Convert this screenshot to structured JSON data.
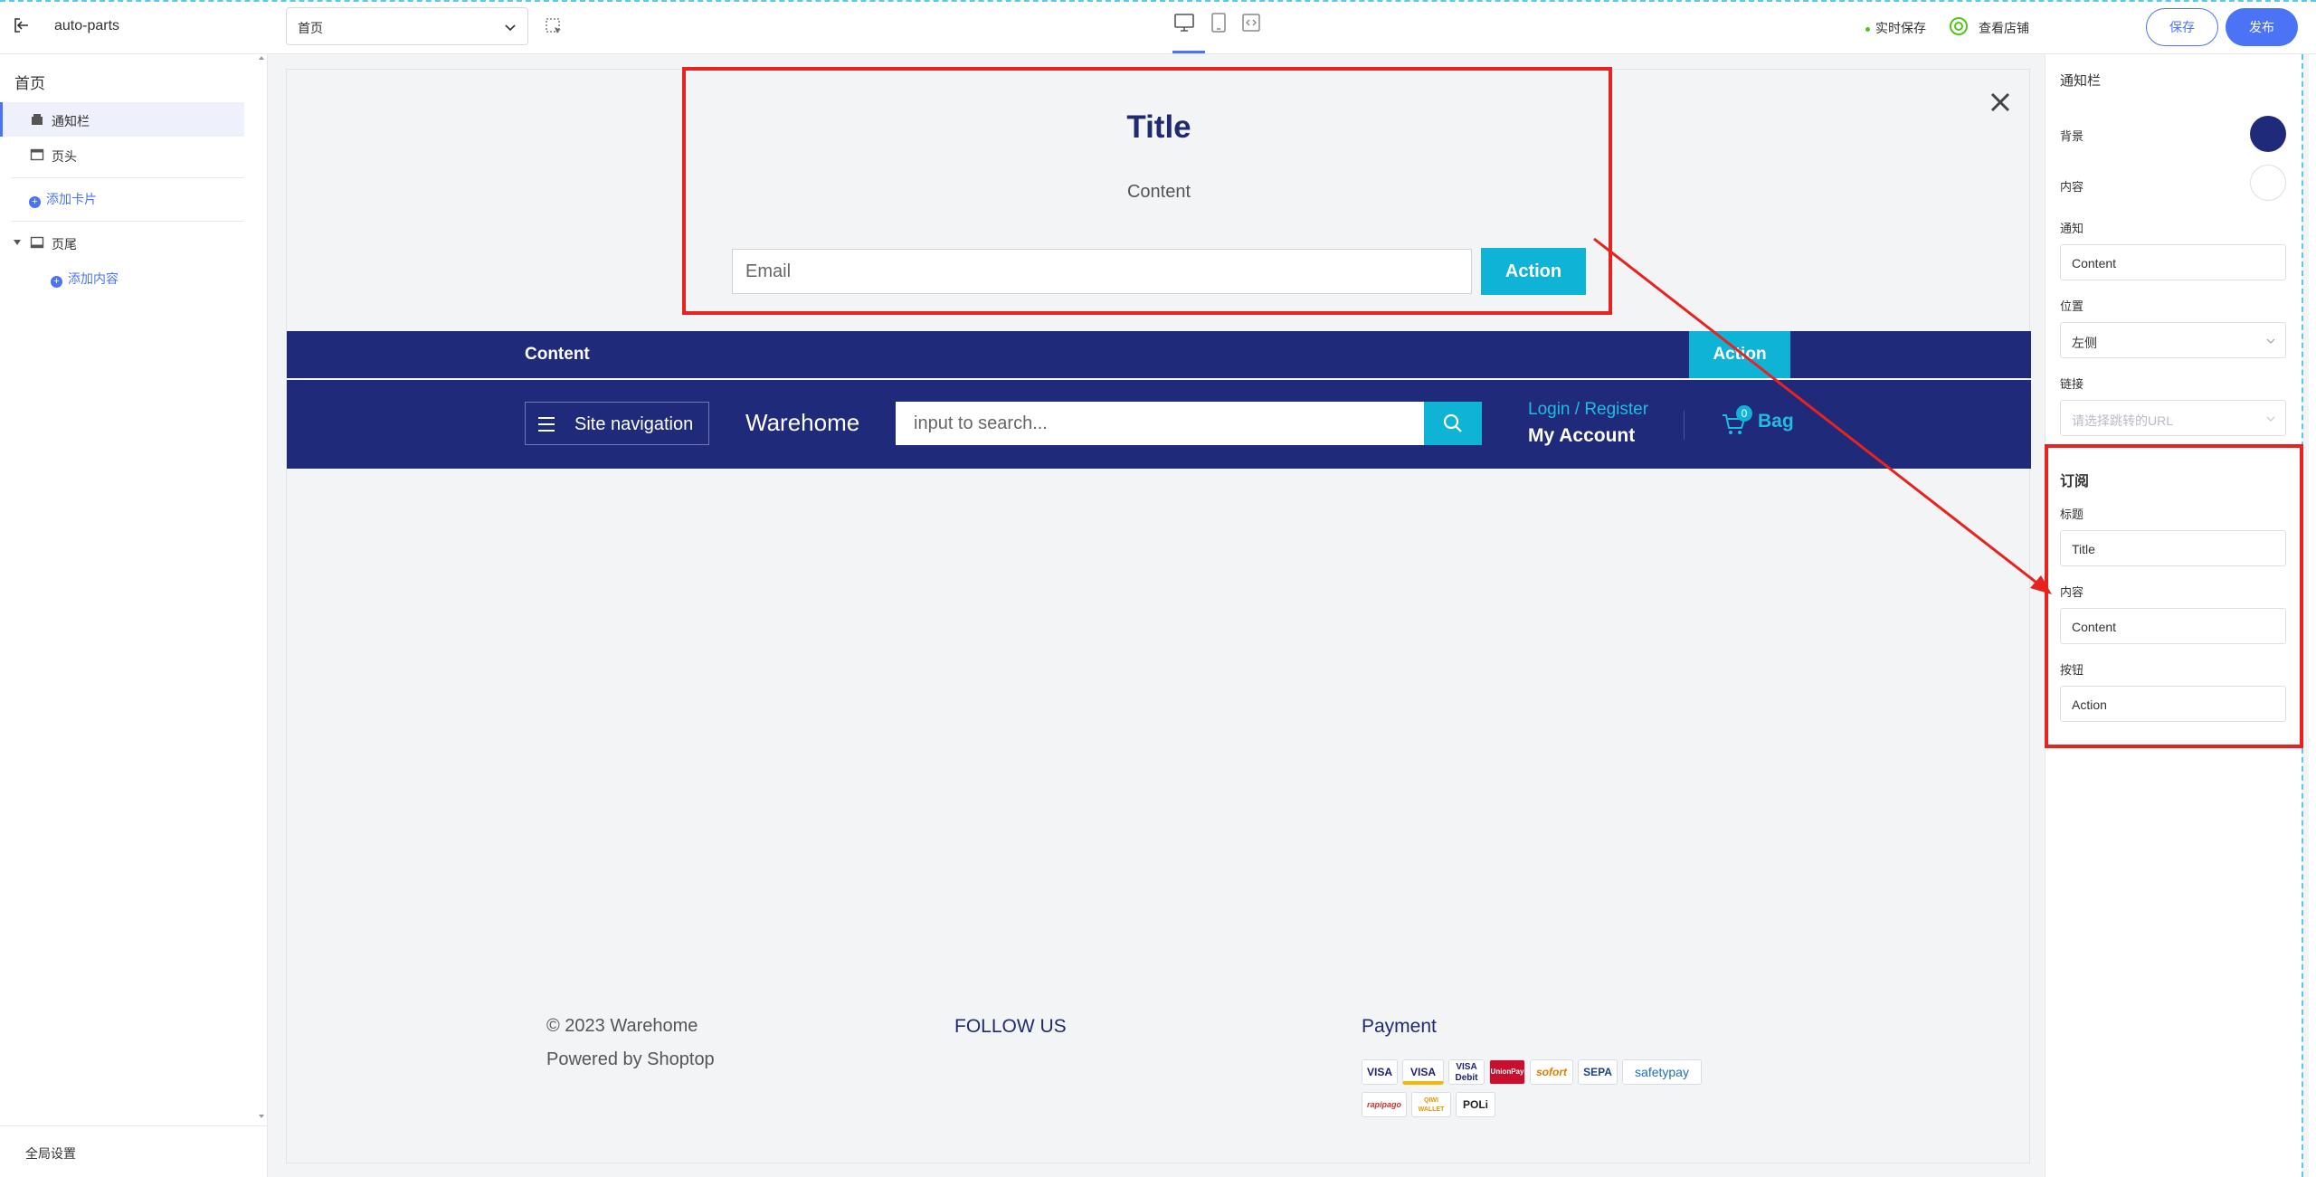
{
  "topbar": {
    "app_name": "auto-parts",
    "page_select_value": "首页",
    "autosave_label": "实时保存",
    "view_store_label": "查看店铺",
    "save_label": "保存",
    "publish_label": "发布"
  },
  "sidebar": {
    "title": "首页",
    "items": [
      {
        "label": "通知栏"
      },
      {
        "label": "页头"
      },
      {
        "label": "页尾"
      }
    ],
    "add_card_label": "添加卡片",
    "add_content_label": "添加内容",
    "global_settings_label": "全局设置"
  },
  "canvas": {
    "subscribe": {
      "title": "Title",
      "content": "Content",
      "email_placeholder": "Email",
      "action_label": "Action"
    },
    "announcement": {
      "content": "Content",
      "action_label": "Action"
    },
    "header": {
      "site_nav_label": "Site navigation",
      "brand": "Warehome",
      "search_placeholder": "input to search...",
      "login_label": "Login / Register",
      "account_label": "My Account",
      "bag_count": "0",
      "bag_label": "Bag"
    },
    "footer": {
      "copyright": "© 2023 Warehome",
      "powered_by": "Powered by Shoptop",
      "follow_label": "FOLLOW US",
      "payment_label": "Payment",
      "payment_methods_row1": [
        "VISA",
        "VISA",
        "VISA Debit",
        "UnionPay",
        "sofort",
        "SEPA",
        "safetypay"
      ],
      "payment_methods_row2": [
        "rapipago",
        "QIWI WALLET",
        "POLi"
      ]
    }
  },
  "panel": {
    "title": "通知栏",
    "background_label": "背景",
    "background_color": "#1f2a7a",
    "content_label": "内容",
    "content_color": "#ffffff",
    "notice_label": "通知",
    "notice_value": "Content",
    "position_label": "位置",
    "position_value": "左侧",
    "link_label": "链接",
    "link_placeholder": "请选择跳转的URL",
    "subscribe_section_title": "订阅",
    "sub_title_label": "标题",
    "sub_title_value": "Title",
    "sub_content_label": "内容",
    "sub_content_value": "Content",
    "sub_button_label": "按钮",
    "sub_button_value": "Action"
  },
  "colors": {
    "accent": "#4a74f5",
    "brand_navy": "#1f2a7a",
    "cyan": "#0fb3d6",
    "highlight_red": "#e8231f"
  }
}
